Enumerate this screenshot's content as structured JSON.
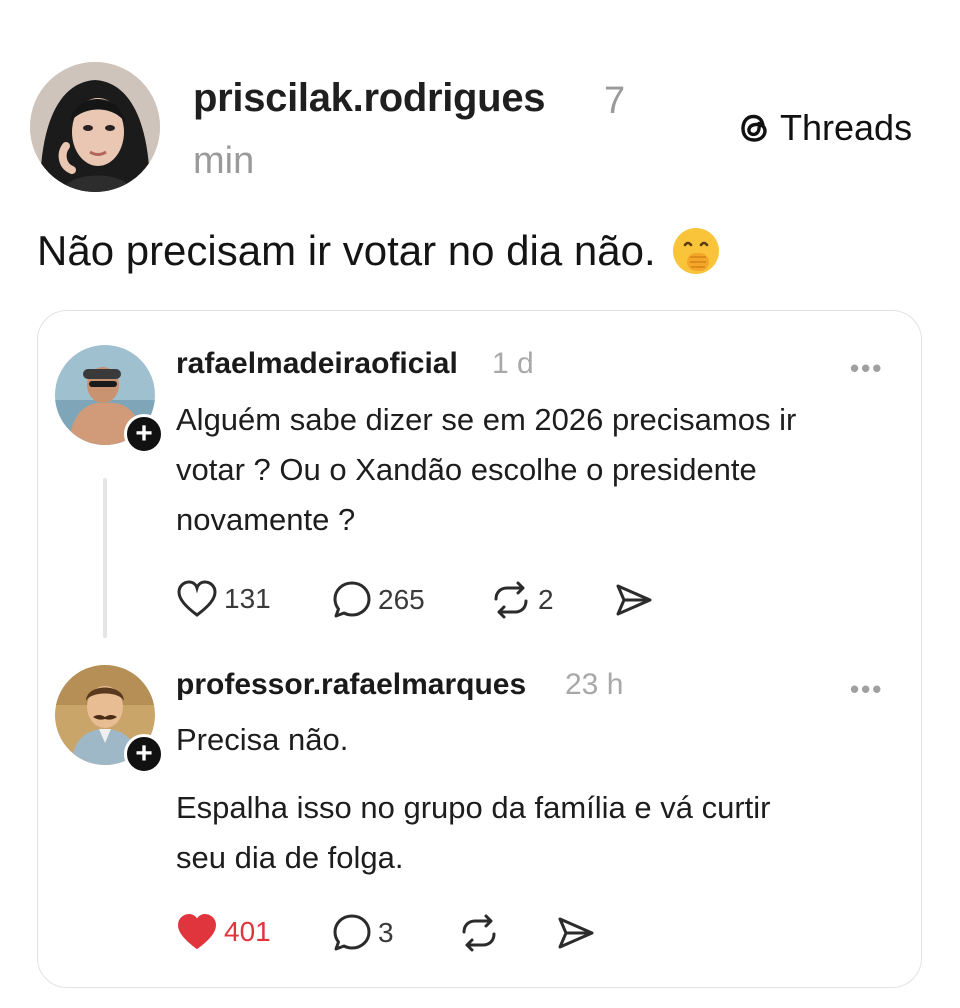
{
  "post": {
    "author": "priscilak.rodrigues",
    "time_part1": "7",
    "time_part2": "min",
    "text": "Não precisam ir votar no dia não.",
    "emoji": "face-with-hand-over-mouth-emoji",
    "brand": "Threads"
  },
  "quoted": {
    "comment1": {
      "username": "rafaelmadeiraoficial",
      "time": "1 d",
      "more": "•••",
      "lines": [
        "Alguém sabe dizer se em 2026 precisamos ir",
        "votar ? Ou o Xandão escolhe o presidente",
        "novamente ?"
      ],
      "likes": "131",
      "replies": "265",
      "reposts": "2"
    },
    "comment2": {
      "username": "professor.rafaelmarques",
      "time": "23 h",
      "more": "•••",
      "line1": "Precisa não.",
      "lines2": [
        "Espalha isso no grupo da família e vá curtir",
        "seu dia de folga."
      ],
      "likes": "401",
      "replies": "3",
      "liked": true
    }
  },
  "colors": {
    "like_active": "#e0353d",
    "muted_text": "#a8a8a8",
    "plus_badge": "#111111"
  }
}
